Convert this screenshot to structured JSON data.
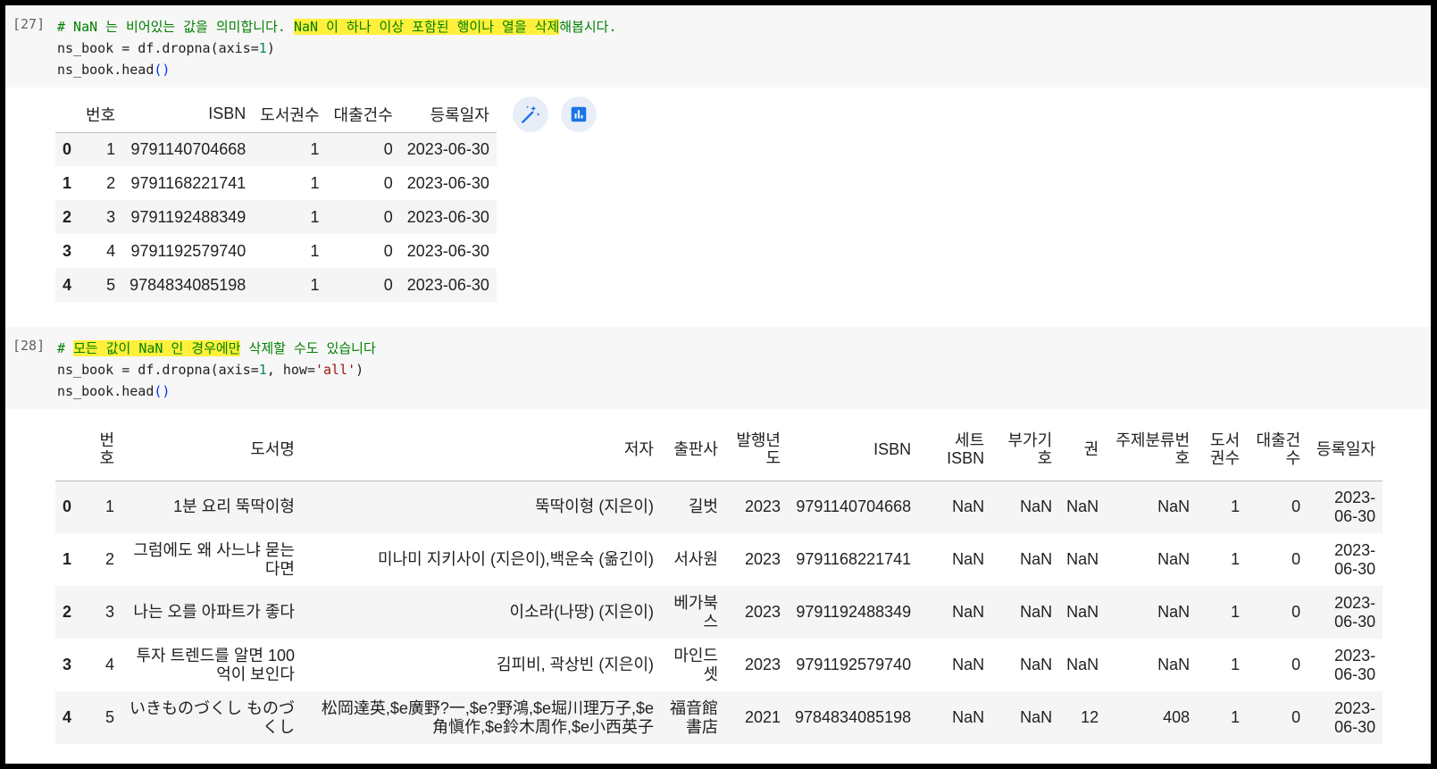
{
  "cell27": {
    "prompt": "[27]",
    "comment_prefix": "# NaN 는 비어있는 값을 의미합니다. ",
    "comment_highlight": "NaN 이 하나 이상 포함된 행이나 열을 삭제",
    "comment_suffix": "해봅시다.",
    "line2_a": "ns_book = df.dropna(axis=",
    "line2_num": "1",
    "line2_b": ")",
    "line3_a": "ns_book.head",
    "line3_par": "()",
    "table": {
      "columns": [
        "",
        "번호",
        "ISBN",
        "도서권수",
        "대출건수",
        "등록일자"
      ],
      "rows": [
        [
          "0",
          "1",
          "9791140704668",
          "1",
          "0",
          "2023-06-30"
        ],
        [
          "1",
          "2",
          "9791168221741",
          "1",
          "0",
          "2023-06-30"
        ],
        [
          "2",
          "3",
          "9791192488349",
          "1",
          "0",
          "2023-06-30"
        ],
        [
          "3",
          "4",
          "9791192579740",
          "1",
          "0",
          "2023-06-30"
        ],
        [
          "4",
          "5",
          "9784834085198",
          "1",
          "0",
          "2023-06-30"
        ]
      ]
    },
    "icons": [
      "magic-wand-icon",
      "bar-chart-icon"
    ]
  },
  "cell28": {
    "prompt": "[28]",
    "comment_prefix": "# ",
    "comment_highlight": "모든 값이 NaN 인 경우에만",
    "comment_suffix": " 삭제할 수도 있습니다",
    "line2_a": "ns_book = df.dropna(axis=",
    "line2_num": "1",
    "line2_mid": ", how=",
    "line2_str": "'all'",
    "line2_b": ")",
    "line3_a": "ns_book.head",
    "line3_par": "()",
    "table": {
      "columns": [
        "",
        "번호",
        "도서명",
        "저자",
        "출판사",
        "발행년도",
        "ISBN",
        "세트 ISBN",
        "부가기호",
        "권",
        "주제분류번호",
        "도서권수",
        "대출건수",
        "등록일자"
      ],
      "rows": [
        [
          "0",
          "1",
          "1분 요리 뚝딱이형",
          "뚝딱이형 (지은이)",
          "길벗",
          "2023",
          "9791140704668",
          "NaN",
          "NaN",
          "NaN",
          "NaN",
          "1",
          "0",
          "2023-06-30"
        ],
        [
          "1",
          "2",
          "그럼에도 왜 사느냐 묻는다면",
          "미나미 지키사이 (지은이),백운숙 (옮긴이)",
          "서사원",
          "2023",
          "9791168221741",
          "NaN",
          "NaN",
          "NaN",
          "NaN",
          "1",
          "0",
          "2023-06-30"
        ],
        [
          "2",
          "3",
          "나는 오를 아파트가 좋다",
          "이소라(나땅) (지은이)",
          "베가북스",
          "2023",
          "9791192488349",
          "NaN",
          "NaN",
          "NaN",
          "NaN",
          "1",
          "0",
          "2023-06-30"
        ],
        [
          "3",
          "4",
          "투자 트렌드를 알면 100억이 보인다",
          "김피비, 곽상빈 (지은이)",
          "마인드셋",
          "2023",
          "9791192579740",
          "NaN",
          "NaN",
          "NaN",
          "NaN",
          "1",
          "0",
          "2023-06-30"
        ],
        [
          "4",
          "5",
          "いきものづくし ものづくし",
          "松岡達英,$e廣野?一,$e?野鴻,$e堀川理万子,$e角愼作,$e鈴木周作,$e小西英子",
          "福音館書店",
          "2021",
          "9784834085198",
          "NaN",
          "NaN",
          "12",
          "408",
          "1",
          "0",
          "2023-06-30"
        ]
      ]
    }
  }
}
